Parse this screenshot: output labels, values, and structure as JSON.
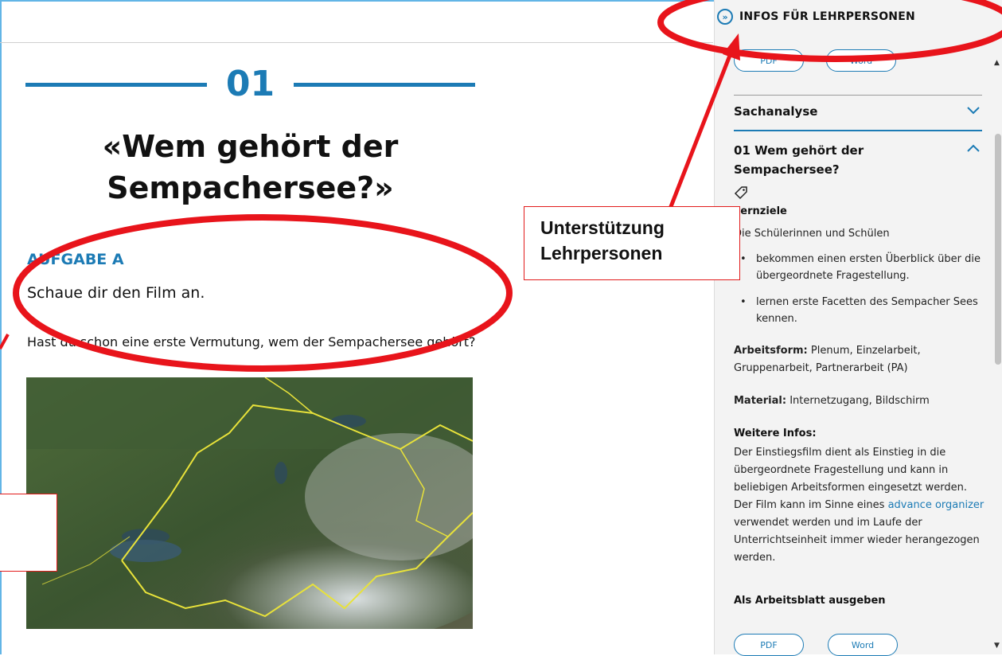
{
  "lesson": {
    "number": "01",
    "title_line1": "«Wem gehört der",
    "title_line2": "Sempachersee?»",
    "task_label": "AUFGABE A",
    "task_text": "Schaue dir den Film an.",
    "question": "Hast du schon eine erste Vermutung, wem der Sempachersee gehört?"
  },
  "sidebar": {
    "infos_label": "INFOS FÜR LEHRPERSONEN",
    "pdf_label": "PDF",
    "word_label": "Word",
    "sachanalyse": "Sachanalyse",
    "section_title_line1": "01 Wem gehört der",
    "section_title_line2": "Sempachersee?",
    "lernziele_heading": "Lernziele",
    "lernziele_intro": "Die Schülerinnen und Schülen",
    "bullets": [
      "bekommen einen ersten Überblick über die übergeordnete Fragestellung.",
      "lernen erste Facetten des Sempacher Sees kennen."
    ],
    "arbeitsform_label": "Arbeitsform:",
    "arbeitsform_value": "Plenum, Einzelarbeit,",
    "arbeitsform_value2": "Gruppenarbeit, Partnerarbeit (PA)",
    "material_label": "Material:",
    "material_value": "Internetzugang, Bildschirm",
    "weitere_heading": "Weitere Infos:",
    "weitere_lines": [
      "Der Einstiegsfilm dient als Einstieg in die",
      "übergeordnete Fragestellung und kann in",
      "beliebigen Arbeitsformen eingesetzt werden.",
      "Der Film kann im Sinne eines",
      "verwendet werden und im Laufe der",
      "Unterrichtseinheit immer wieder herangezogen",
      "werden."
    ],
    "link_text": "advance organizer",
    "arbeitsblatt": "Als Arbeitsblatt ausgeben"
  },
  "annotation": {
    "line1": "Unterstützung",
    "line2": "Lehrpersonen"
  },
  "colors": {
    "accent": "#1c7bb5",
    "annotation": "#e8141b"
  }
}
